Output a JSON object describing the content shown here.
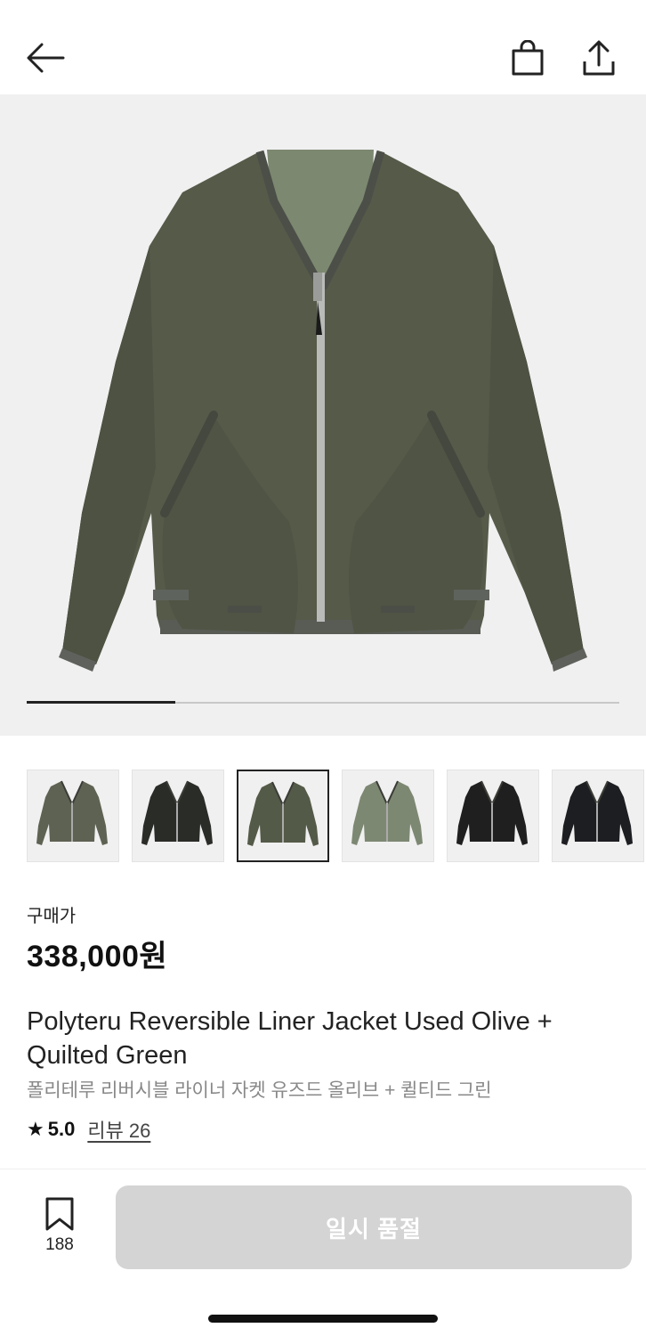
{
  "header": {
    "back_icon": "arrow-left-icon",
    "cart_icon": "shopping-bag-icon",
    "share_icon": "share-upload-icon"
  },
  "gallery": {
    "progress": 0.25,
    "thumbnails": [
      {
        "color": "#5e6253",
        "selected": false
      },
      {
        "color": "#2a2c28",
        "selected": false
      },
      {
        "color": "#545a48",
        "selected": true
      },
      {
        "color": "#7d8873",
        "selected": false
      },
      {
        "color": "#1f1f20",
        "selected": false
      },
      {
        "color": "#1d1e21",
        "selected": false
      }
    ]
  },
  "product": {
    "price_label": "구매가",
    "price": "338,000원",
    "title": "Polyteru Reversible Liner Jacket Used Olive + Quilted Green",
    "subtitle": "폴리테루 리버시블 라이너 자켓 유즈드 올리브 + 퀼티드 그린",
    "rating": "5.0",
    "review_link": "리뷰 26"
  },
  "bottom": {
    "wish_count": "188",
    "action_label": "일시 품절"
  },
  "colors": {
    "jacket": "#555a49",
    "disabled_button": "#d4d4d4"
  }
}
